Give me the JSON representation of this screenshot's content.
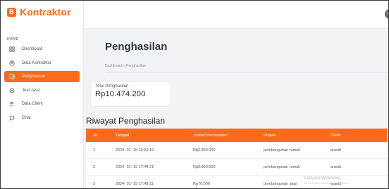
{
  "brand": {
    "logo_glyph": "B",
    "title": "Kontraktor",
    "color": "#ff6a1a"
  },
  "sidebar": {
    "heading": "HOME",
    "items": [
      {
        "label": "Dashboard",
        "icon": "grid-icon",
        "active": false
      },
      {
        "label": "Data Kontraktor",
        "icon": "user-circle-icon",
        "active": false
      },
      {
        "label": "Penghasilan",
        "icon": "wallet-icon",
        "active": true
      },
      {
        "label": "Jual Jasa",
        "icon": "sync-icon",
        "active": false
      },
      {
        "label": "Data Client",
        "icon": "users-icon",
        "active": false
      },
      {
        "label": "Chat",
        "icon": "chat-icon",
        "active": false
      }
    ]
  },
  "page": {
    "title": "Penghasilan",
    "breadcrumb": "Dashboard > Penghasilan"
  },
  "stat": {
    "label": "Total Penghasilan",
    "value": "Rp10.474.200"
  },
  "history": {
    "title": "Riwayat Penghasilan",
    "columns": [
      "No",
      "Tanggal",
      "Jumlah Pendapatan",
      "Proyek",
      "Client"
    ],
    "rows": [
      {
        "no": "1",
        "date": "2024- 01- 15 15:50:15",
        "amount": "Rp2.850.000",
        "project": "pembangunan rumah",
        "client": "arasid"
      },
      {
        "no": "2",
        "date": "2024- 01- 15 17:44:21",
        "amount": "Rp2.850.000",
        "project": "pembangunan rumah",
        "client": "arasid"
      },
      {
        "no": "3",
        "date": "2024- 01- 15 17:48:11",
        "amount": "Rp76.000",
        "project": "pembangunan jalan",
        "client": "arasid"
      }
    ]
  },
  "watermark": {
    "line1": "Activate Windows",
    "line2": "Go to Settings to activate Windows."
  }
}
